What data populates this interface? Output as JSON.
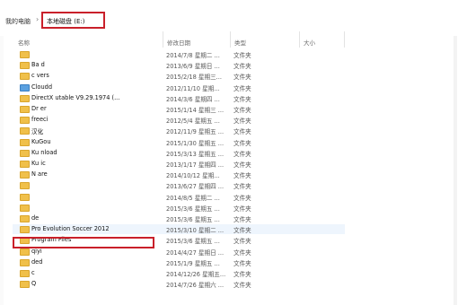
{
  "breadcrumb": {
    "root": "我的电脑",
    "separator": "›",
    "current": "本地磁盘 (E:)"
  },
  "columns": {
    "name": "名称",
    "modified": "修改日期",
    "type": "类型",
    "size": "大小"
  },
  "rows": [
    {
      "name": "",
      "date": "2014/7/8 星期二 ...",
      "type": "文件夹"
    },
    {
      "name": "Ba           d",
      "date": "2013/6/9 星期日 ...",
      "type": "文件夹"
    },
    {
      "name": "c          vers",
      "date": "2015/2/18 星期三...",
      "type": "文件夹"
    },
    {
      "name": "Cloudd",
      "date": "2012/11/10 星期...",
      "type": "文件夹",
      "icon": "sys"
    },
    {
      "name": "DirectX             utable V9.29.1974 (...",
      "date": "2014/3/6 星期四 ...",
      "type": "文件夹"
    },
    {
      "name": "Dr         er",
      "date": "2015/1/14 星期三 ...",
      "type": "文件夹"
    },
    {
      "name": "freeci",
      "date": "2012/5/4 星期五 ...",
      "type": "文件夹"
    },
    {
      "name": "汉化",
      "date": "2012/11/9 星期五 ...",
      "type": "文件夹"
    },
    {
      "name": "KuGou",
      "date": "2015/1/30 星期五 ...",
      "type": "文件夹"
    },
    {
      "name": "Ku     nload",
      "date": "2015/3/13 星期五 ...",
      "type": "文件夹"
    },
    {
      "name": "Ku          ic",
      "date": "2013/1/17 星期四 ...",
      "type": "文件夹"
    },
    {
      "name": "N         are",
      "date": "2014/10/12 星期...",
      "type": "文件夹"
    },
    {
      "name": "",
      "date": "2013/6/27 星期四 ...",
      "type": "文件夹"
    },
    {
      "name": "",
      "date": "2014/8/5 星期二 ...",
      "type": "文件夹"
    },
    {
      "name": "",
      "date": "2015/3/6 星期五 ...",
      "type": "文件夹"
    },
    {
      "name": "de",
      "date": "2015/3/6 星期五 ...",
      "type": "文件夹"
    },
    {
      "name": "Pro Evolution Soccer 2012",
      "date": "2015/3/10 星期二 ...",
      "type": "文件夹",
      "selected": true
    },
    {
      "name": "Program Files",
      "date": "2015/3/6 星期五 ...",
      "type": "文件夹"
    },
    {
      "name": "qiyi",
      "date": "2014/4/27 星期日 ...",
      "type": "文件夹"
    },
    {
      "name": "         ded",
      "date": "2015/1/9 星期五 ...",
      "type": "文件夹"
    },
    {
      "name": "c",
      "date": "2014/12/26 星期五...",
      "type": "文件夹"
    },
    {
      "name": "Q",
      "date": "2014/7/26 星期六 ...",
      "type": "文件夹"
    }
  ]
}
